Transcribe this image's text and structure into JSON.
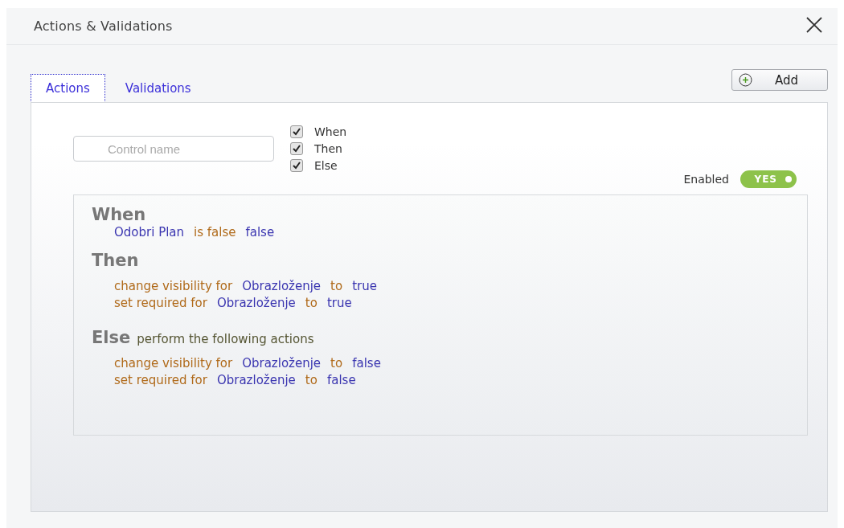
{
  "dialog": {
    "title": "Actions & Validations"
  },
  "tabs": [
    {
      "label": "Actions",
      "selected": true
    },
    {
      "label": "Validations",
      "selected": false
    }
  ],
  "add_button": {
    "label": "Add"
  },
  "control_field": {
    "placeholder": "Control name"
  },
  "filters": [
    {
      "label": "When",
      "checked": true
    },
    {
      "label": "Then",
      "checked": true
    },
    {
      "label": "Else",
      "checked": true
    }
  ],
  "enabled": {
    "label": "Enabled",
    "on": true,
    "toggle_text": "YES"
  },
  "sections": [
    {
      "heading": "When",
      "lines": [
        [
          {
            "text": "Odobri Plan",
            "kind": "value"
          },
          {
            "text": "is false",
            "kind": "keyword"
          },
          {
            "text": "false",
            "kind": "value"
          }
        ]
      ]
    },
    {
      "heading": "Then",
      "lines": [
        [
          {
            "text": "change visibility for",
            "kind": "keyword"
          },
          {
            "text": "Obrazloženje",
            "kind": "value"
          },
          {
            "text": "to",
            "kind": "keyword"
          },
          {
            "text": "true",
            "kind": "value"
          }
        ],
        [
          {
            "text": "set required for",
            "kind": "keyword"
          },
          {
            "text": "Obrazloženje",
            "kind": "value"
          },
          {
            "text": "to",
            "kind": "keyword"
          },
          {
            "text": "true",
            "kind": "value"
          }
        ]
      ]
    },
    {
      "heading": "Else",
      "note": "perform the following actions",
      "lines": [
        [
          {
            "text": "change visibility for",
            "kind": "keyword"
          },
          {
            "text": "Obrazloženje",
            "kind": "value"
          },
          {
            "text": "to",
            "kind": "keyword"
          },
          {
            "text": "false",
            "kind": "value"
          }
        ],
        [
          {
            "text": "set required for",
            "kind": "keyword"
          },
          {
            "text": "Obrazloženje",
            "kind": "value"
          },
          {
            "text": "to",
            "kind": "keyword"
          },
          {
            "text": "false",
            "kind": "value"
          }
        ]
      ]
    }
  ]
}
